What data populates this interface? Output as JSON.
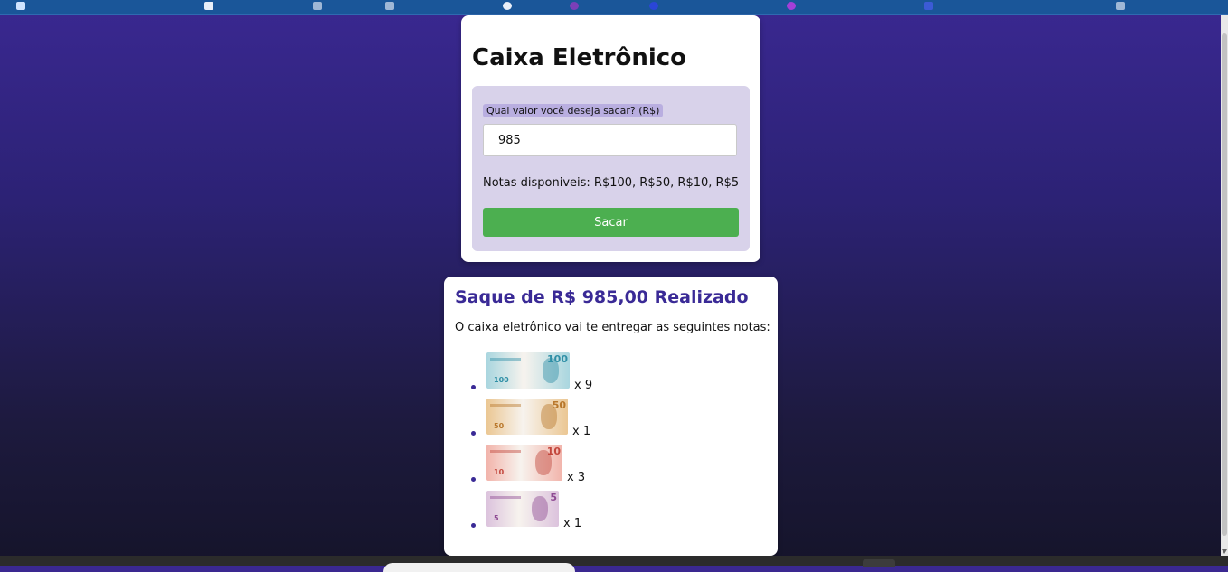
{
  "atm": {
    "title": "Caixa Eletrônico",
    "amount_label": "Qual valor você deseja sacar? (R$)",
    "amount_value": "985",
    "available_notes": "Notas disponiveis: R$100, R$50, R$10, R$5",
    "withdraw_button": "Sacar"
  },
  "result": {
    "title": "Saque de R$ 985,00 Realizado",
    "message": "O caixa eletrônico vai te entregar as seguintes notas:",
    "notes": [
      {
        "value": "100",
        "quantity": "x 9",
        "color": "#a9d6df",
        "accent": "#2f8fa6"
      },
      {
        "value": "50",
        "quantity": "x 1",
        "color": "#ebc793",
        "accent": "#b9782c"
      },
      {
        "value": "10",
        "quantity": "x 3",
        "color": "#f2b4ab",
        "accent": "#c2463c"
      },
      {
        "value": "5",
        "quantity": "x 1",
        "color": "#dcc3dd",
        "accent": "#8e4a93"
      }
    ]
  }
}
